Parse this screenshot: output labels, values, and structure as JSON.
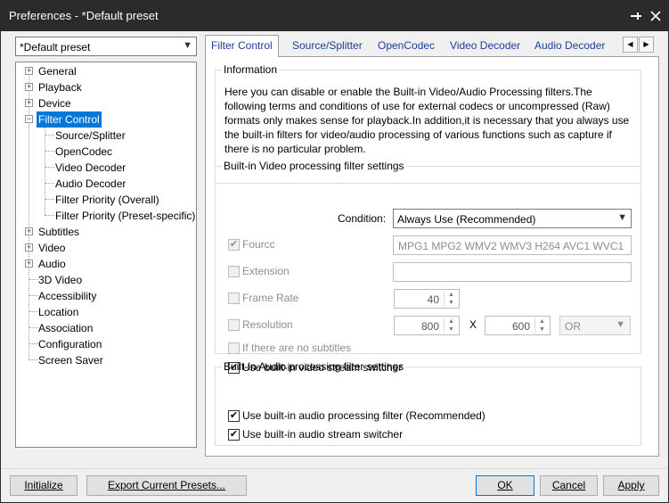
{
  "window": {
    "title": "Preferences - *Default preset"
  },
  "preset": {
    "selected": "*Default preset"
  },
  "tree": {
    "general": "General",
    "playback": "Playback",
    "device": "Device",
    "filter_control": "Filter Control",
    "source_splitter": "Source/Splitter",
    "opencodec": "OpenCodec",
    "video_decoder": "Video Decoder",
    "audio_decoder": "Audio Decoder",
    "filter_priority_overall": "Filter Priority (Overall)",
    "filter_priority_preset": "Filter Priority (Preset-specific)",
    "subtitles": "Subtitles",
    "video": "Video",
    "audio": "Audio",
    "video_3d": "3D Video",
    "accessibility": "Accessibility",
    "location": "Location",
    "association": "Association",
    "configuration": "Configuration",
    "screen_saver": "Screen Saver"
  },
  "tabs": {
    "filter_control": "Filter Control",
    "source_splitter": "Source/Splitter",
    "opencodec": "OpenCodec",
    "video_decoder": "Video Decoder",
    "audio_decoder": "Audio Decoder"
  },
  "info": {
    "legend": "Information",
    "line1": "Here you can disable or enable the Built-in Video/Audio Processing filters.The",
    "line2": "following terms and conditions of use for external codecs or uncompressed (Raw)",
    "line3": "formats only makes sense for playback.In addition,it is necessary that you always use",
    "line4": "the built-in filters for video/audio processing of various functions such as capture if",
    "line5": "there is no particular problem."
  },
  "video": {
    "legend": "Built-in Video processing filter settings",
    "condition_label": "Condition:",
    "condition_value": "Always Use (Recommended)",
    "fourcc_label": "Fourcc",
    "fourcc_value": "MPG1 MPG2 WMV2 WMV3 H264 AVC1 WVC1",
    "extension_label": "Extension",
    "extension_value": "",
    "framerate_label": "Frame Rate",
    "framerate_value": "40",
    "resolution_label": "Resolution",
    "res_width": "800",
    "res_x": "X",
    "res_height": "600",
    "res_op": "OR",
    "no_subtitles_label": "If there are no subtitles",
    "stream_switcher_label": "Use built-in video stream switcher"
  },
  "audio": {
    "legend": "Built-in Audio processing filter settings",
    "filter_label": "Use built-in audio processing filter (Recommended)",
    "stream_switcher_label": "Use built-in audio stream switcher"
  },
  "buttons": {
    "initialize": "Initialize",
    "export": "Export Current Presets...",
    "ok": "OK",
    "cancel": "Cancel",
    "apply": "Apply"
  }
}
